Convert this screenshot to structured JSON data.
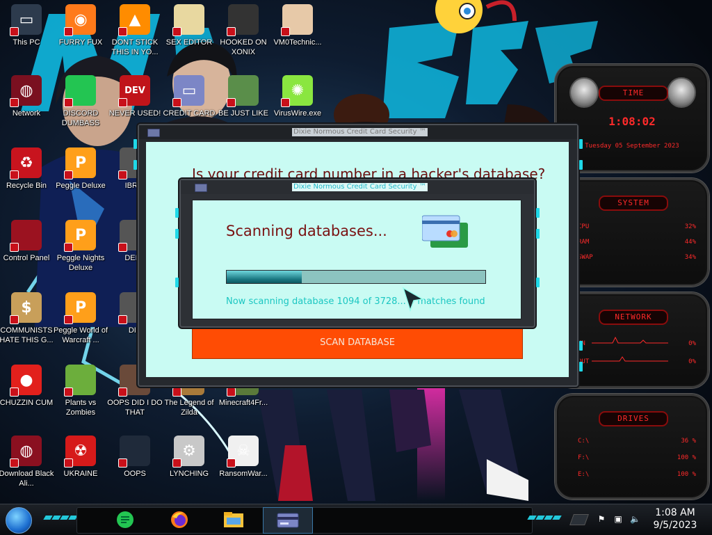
{
  "desktop": {
    "icons": [
      {
        "label": "This PC",
        "icon": "computer-icon"
      },
      {
        "label": "FURRY FUX",
        "icon": "firefox-icon"
      },
      {
        "label": "DONT STICK THIS IN YO...",
        "icon": "vlc-icon"
      },
      {
        "label": "SEX EDITOR",
        "icon": "hxd-icon"
      },
      {
        "label": "HOOKED ON XONIX",
        "icon": "xonix-icon"
      },
      {
        "label": "VM0Technic...",
        "icon": "doctor-icon"
      },
      {
        "label": "Network",
        "icon": "network-icon"
      },
      {
        "label": "DISCORD DUMBASS",
        "icon": "notes-app-icon"
      },
      {
        "label": "NEVER USED!",
        "icon": "dev-icon"
      },
      {
        "label": "CREDIT CARD",
        "icon": "credit-card-icon"
      },
      {
        "label": "BE JUST LIKE",
        "icon": "santa-icon"
      },
      {
        "label": "VirusWire.exe",
        "icon": "lime-icon"
      },
      {
        "label": "Recycle Bin",
        "icon": "recycle-bin-icon"
      },
      {
        "label": "Peggle Deluxe",
        "icon": "peggle-icon"
      },
      {
        "label": "IBRAI",
        "icon": "app-icon"
      },
      {
        "label": "Control Panel",
        "icon": "control-panel-icon"
      },
      {
        "label": "Peggle Nights Deluxe",
        "icon": "peggle-icon"
      },
      {
        "label": "DEEZ",
        "icon": "app-icon"
      },
      {
        "label": "COMMUNISTS HATE THIS G...",
        "icon": "money-bag-icon"
      },
      {
        "label": "Peggle World of Warcraft ...",
        "icon": "peggle-icon"
      },
      {
        "label": "DIE",
        "icon": "app-icon"
      },
      {
        "label": "CHUZZIN CUM",
        "icon": "chuzzle-icon"
      },
      {
        "label": "Plants vs Zombies",
        "icon": "plants-vs-zombies-icon"
      },
      {
        "label": "OOPS DID I DO THAT",
        "icon": "person-icon"
      },
      {
        "label": "The Legend of Zilda",
        "icon": "zelda-icon"
      },
      {
        "label": "Minecraft4Fr...",
        "icon": "minecraft-icon"
      },
      {
        "label": "Download Black Ali...",
        "icon": "alien-icon"
      },
      {
        "label": "UKRAINE",
        "icon": "radiation-icon"
      },
      {
        "label": "OOPS",
        "icon": "oops-icon"
      },
      {
        "label": "LYNCHING",
        "icon": "gear-bundle-icon"
      },
      {
        "label": "RansomWar...",
        "icon": "skull-icon"
      }
    ]
  },
  "widget": {
    "time_title": "TIME",
    "time_value": "1:08:02",
    "date_value": "Tuesday 05 September 2023",
    "system_title": "SYSTEM",
    "system_rows": [
      {
        "label": "CPU",
        "value": "32%"
      },
      {
        "label": "RAM",
        "value": "44%"
      },
      {
        "label": "SWAP",
        "value": "34%"
      }
    ],
    "network_title": "NETWORK",
    "network_rows": [
      {
        "label": "IN",
        "value": "0%"
      },
      {
        "label": "OUT",
        "value": "0%"
      }
    ],
    "drives_title": "DRIVES",
    "drive_rows": [
      {
        "label": "C:\\",
        "value": "36 %"
      },
      {
        "label": "F:\\",
        "value": "100 %"
      },
      {
        "label": "E:\\",
        "value": "100 %"
      }
    ]
  },
  "outer_window": {
    "title": "Dixie Normous Credit Card Security ™",
    "headline": "Is your credit card number in a hacker's database?",
    "button_label": "SCAN DATABASE"
  },
  "inner_window": {
    "title": "Dixie Normous Credit Card Security ™",
    "heading": "Scanning databases...",
    "status": "Now scanning database 1094 of 3728... 0 matches found",
    "progress_fraction": 0.29
  },
  "taskbar": {
    "apps": [
      "notes-app-icon",
      "firefox-icon",
      "file-explorer-icon",
      "credit-card-icon"
    ],
    "clock_time": "1:08 AM",
    "clock_date": "9/5/2023"
  },
  "colors": {
    "accent_cyan": "#1fd8e8",
    "window_bg": "#c9fbf3",
    "button_orange": "#ff4c04",
    "headline_red": "#6b1010",
    "widget_red": "#ff2a2a"
  }
}
